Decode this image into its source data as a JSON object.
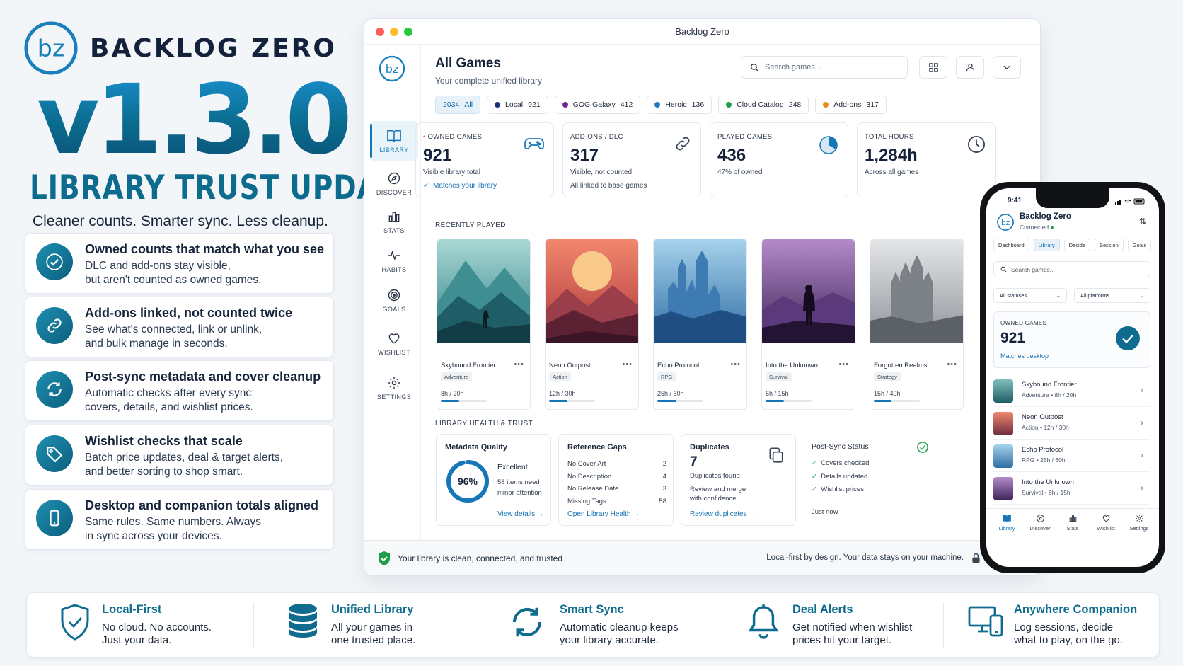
{
  "brand": {
    "name": "BACKLOG ZERO",
    "logo_text": "bz",
    "version": "v1.3.0",
    "subtitle": "LIBRARY TRUST UPDATE",
    "tagline": "Cleaner counts. Smarter sync. Less cleanup."
  },
  "features": [
    {
      "icon": "check-icon",
      "title": "Owned counts that match what you see",
      "line1": "DLC and add-ons stay visible,",
      "line2": "but aren't counted as owned games."
    },
    {
      "icon": "link-icon",
      "title": "Add-ons linked, not counted twice",
      "line1": "See what's connected, link or unlink,",
      "line2": "and bulk manage in seconds."
    },
    {
      "icon": "sync-icon",
      "title": "Post-sync metadata and cover cleanup",
      "line1": "Automatic checks after every sync:",
      "line2": "covers, details, and wishlist prices."
    },
    {
      "icon": "tag-icon",
      "title": "Wishlist checks that scale",
      "line1": "Batch price updates, deal & target alerts,",
      "line2": "and better sorting to shop smart."
    },
    {
      "icon": "phone-icon",
      "title": "Desktop and companion totals aligned",
      "line1": "Same rules. Same numbers. Always",
      "line2": "in sync across your devices."
    }
  ],
  "window": {
    "title": "Backlog Zero",
    "sidebar": [
      {
        "label": "LIBRARY",
        "icon": "book-icon"
      },
      {
        "label": "DISCOVER",
        "icon": "compass-icon"
      },
      {
        "label": "STATS",
        "icon": "bar-chart-icon"
      },
      {
        "label": "HABITS",
        "icon": "pulse-icon"
      },
      {
        "label": "GOALS",
        "icon": "target-icon"
      },
      {
        "label": "WISHLIST",
        "icon": "heart-icon"
      },
      {
        "label": "SETTINGS",
        "icon": "gear-icon"
      }
    ],
    "page_title": "All Games",
    "page_subtitle": "Your complete unified library",
    "search_placeholder": "Search games...",
    "chips": [
      {
        "count": "2034",
        "label": "All",
        "color": ""
      },
      {
        "count": "921",
        "label": "Local",
        "color": "#1a2f7a"
      },
      {
        "count": "412",
        "label": "GOG Galaxy",
        "color": "#6b2c8e"
      },
      {
        "count": "136",
        "label": "Heroic",
        "color": "#1f7cc4"
      },
      {
        "count": "248",
        "label": "Cloud Catalog",
        "color": "#1f9d48"
      },
      {
        "count": "317",
        "label": "Add-ons",
        "color": "#e58a1a"
      }
    ],
    "stats": [
      {
        "label": "OWNED GAMES",
        "value": "921",
        "note": "Visible library total",
        "note2": "Matches your library",
        "icon": "gamepad-icon"
      },
      {
        "label": "ADD-ONS / DLC",
        "value": "317",
        "note": "Visible, not counted",
        "note2": "All linked to base games",
        "icon": "link-icon"
      },
      {
        "label": "PLAYED GAMES",
        "value": "436",
        "note": "47% of owned",
        "note2": "",
        "icon": "pie-icon"
      },
      {
        "label": "TOTAL HOURS",
        "value": "1,284h",
        "note": "Across all games",
        "note2": "",
        "icon": "clock-icon"
      }
    ],
    "recent_label": "RECENTLY PLAYED",
    "games": [
      {
        "title": "Skybound Frontier",
        "genre": "Adventure",
        "hours": "8h / 20h",
        "progress": 0.4
      },
      {
        "title": "Neon Outpost",
        "genre": "Action",
        "hours": "12h / 30h",
        "progress": 0.4
      },
      {
        "title": "Echo Protocol",
        "genre": "RPG",
        "hours": "25h / 60h",
        "progress": 0.42
      },
      {
        "title": "Into the Unknown",
        "genre": "Survival",
        "hours": "6h / 15h",
        "progress": 0.4
      },
      {
        "title": "Forgotten Realms",
        "genre": "Strategy",
        "hours": "15h / 40h",
        "progress": 0.38
      }
    ],
    "health_label": "LIBRARY HEALTH & TRUST",
    "metadata": {
      "title": "Metadata Quality",
      "percent": "96%",
      "percent_value": 96,
      "grade": "Excellent",
      "line1": "58 items need",
      "line2": "minor attention",
      "link": "View details →"
    },
    "gaps": {
      "title": "Reference Gaps",
      "rows": [
        {
          "label": "No Cover Art",
          "value": "2"
        },
        {
          "label": "No Description",
          "value": "4"
        },
        {
          "label": "No Release Date",
          "value": "3"
        },
        {
          "label": "Missing Tags",
          "value": "58"
        }
      ],
      "link": "Open Library Health →"
    },
    "duplicates": {
      "title": "Duplicates",
      "value": "7",
      "found": "Duplicates found",
      "line1": "Review and merge",
      "line2": "with confidence",
      "link": "Review duplicates →"
    },
    "postsync": {
      "title": "Post-Sync Status",
      "items": [
        "Covers checked",
        "Details updated",
        "Wishlist prices"
      ],
      "time": "Just now"
    },
    "status_left": "Your library is clean, connected, and trusted",
    "status_right": "Local-first by design. Your data stays on your machine."
  },
  "phone": {
    "time": "9:41",
    "app": "Backlog Zero",
    "status": "Connected",
    "tabs": [
      "Dashboard",
      "Library",
      "Decide",
      "Session",
      "Goals"
    ],
    "search": "Search games...",
    "filter1": "All statuses",
    "filter2": "All platforms",
    "owned_label": "OWNED GAMES",
    "owned_value": "921",
    "owned_note": "Matches desktop",
    "rows": [
      {
        "name": "Skybound Frontier",
        "meta": "Adventure • 8h / 20h"
      },
      {
        "name": "Neon Outpost",
        "meta": "Action • 12h / 30h"
      },
      {
        "name": "Echo Protocol",
        "meta": "RPG • 25h / 60h"
      },
      {
        "name": "Into the Unknown",
        "meta": "Survival • 6h / 15h"
      }
    ],
    "nav": [
      "Library",
      "Discover",
      "Stats",
      "Wishlist",
      "Settings"
    ]
  },
  "footer": [
    {
      "title": "Local-First",
      "line1": "No cloud. No accounts.",
      "line2": "Just your data.",
      "icon": "shield-icon"
    },
    {
      "title": "Unified Library",
      "line1": "All your games in",
      "line2": "one trusted place.",
      "icon": "database-icon"
    },
    {
      "title": "Smart Sync",
      "line1": "Automatic cleanup keeps",
      "line2": "your library accurate.",
      "icon": "sync-icon"
    },
    {
      "title": "Deal Alerts",
      "line1": "Get notified when wishlist",
      "line2": "prices hit your target.",
      "icon": "bell-icon"
    },
    {
      "title": "Anywhere Companion",
      "line1": "Log sessions, decide",
      "line2": "what to play, on the go.",
      "icon": "devices-icon"
    }
  ],
  "colors": {
    "accent": "#1577b8",
    "teal": "#0f6c8f",
    "success": "#1f9d48"
  }
}
